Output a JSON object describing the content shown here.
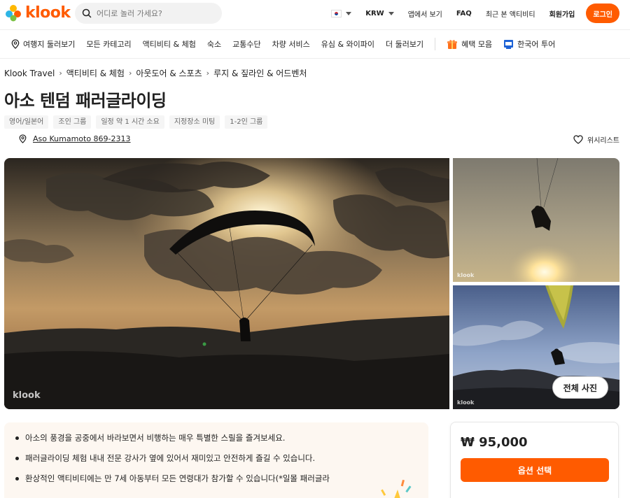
{
  "header": {
    "logo_text": "klook",
    "search_placeholder": "어디로 놀러 가세요?",
    "currency": "KRW",
    "app_link": "앱에서 보기",
    "faq": "FAQ",
    "recent": "최근 본 액티비티",
    "signup": "회원가입",
    "login": "로그인",
    "brand_color": "#ff5b00"
  },
  "nav": {
    "items": [
      {
        "label": "여행지 둘러보기",
        "icon": "location-pin-icon"
      },
      {
        "label": "모든 카테고리"
      },
      {
        "label": "액티비티 & 체험"
      },
      {
        "label": "숙소"
      },
      {
        "label": "교통수단"
      },
      {
        "label": "차량 서비스"
      },
      {
        "label": "유심 & 와이파이"
      },
      {
        "label": "더 둘러보기"
      }
    ],
    "deals": {
      "label": "혜택 모음",
      "icon": "gift-icon"
    },
    "korean_tour": {
      "label": "한국어 투어",
      "icon": "flag-icon"
    }
  },
  "breadcrumb": [
    "Klook Travel",
    "액티비티 & 체험",
    "아웃도어 & 스포츠",
    "루지 & 짚라인 & 어드벤처"
  ],
  "title": "아소 텐덤 패러글라이딩",
  "tags": [
    "영어/일본어",
    "조인 그룹",
    "일정 약 1 시간 소요",
    "지정장소 미팅",
    "1-2인 그룹"
  ],
  "location": "Aso Kumamoto 869-2313",
  "wishlist": "위시리스트",
  "gallery": {
    "watermark": "klook",
    "all_photos": "전체 사진"
  },
  "highlights": [
    "아소의 풍경을 공중에서 바라보면서 비행하는 매우 특별한 스릴을 즐겨보세요.",
    "패러글라이딩 체험 내내 전문 강사가 옆에 있어서 재미있고 안전하게 즐길 수 있습니다.",
    "환상적인 액티비티에는 만 7세 아동부터 모든 연령대가 참가할 수 있습니다(*일몰 패러글라"
  ],
  "booking": {
    "price": "₩ 95,000",
    "select_label": "옵션 선택"
  }
}
